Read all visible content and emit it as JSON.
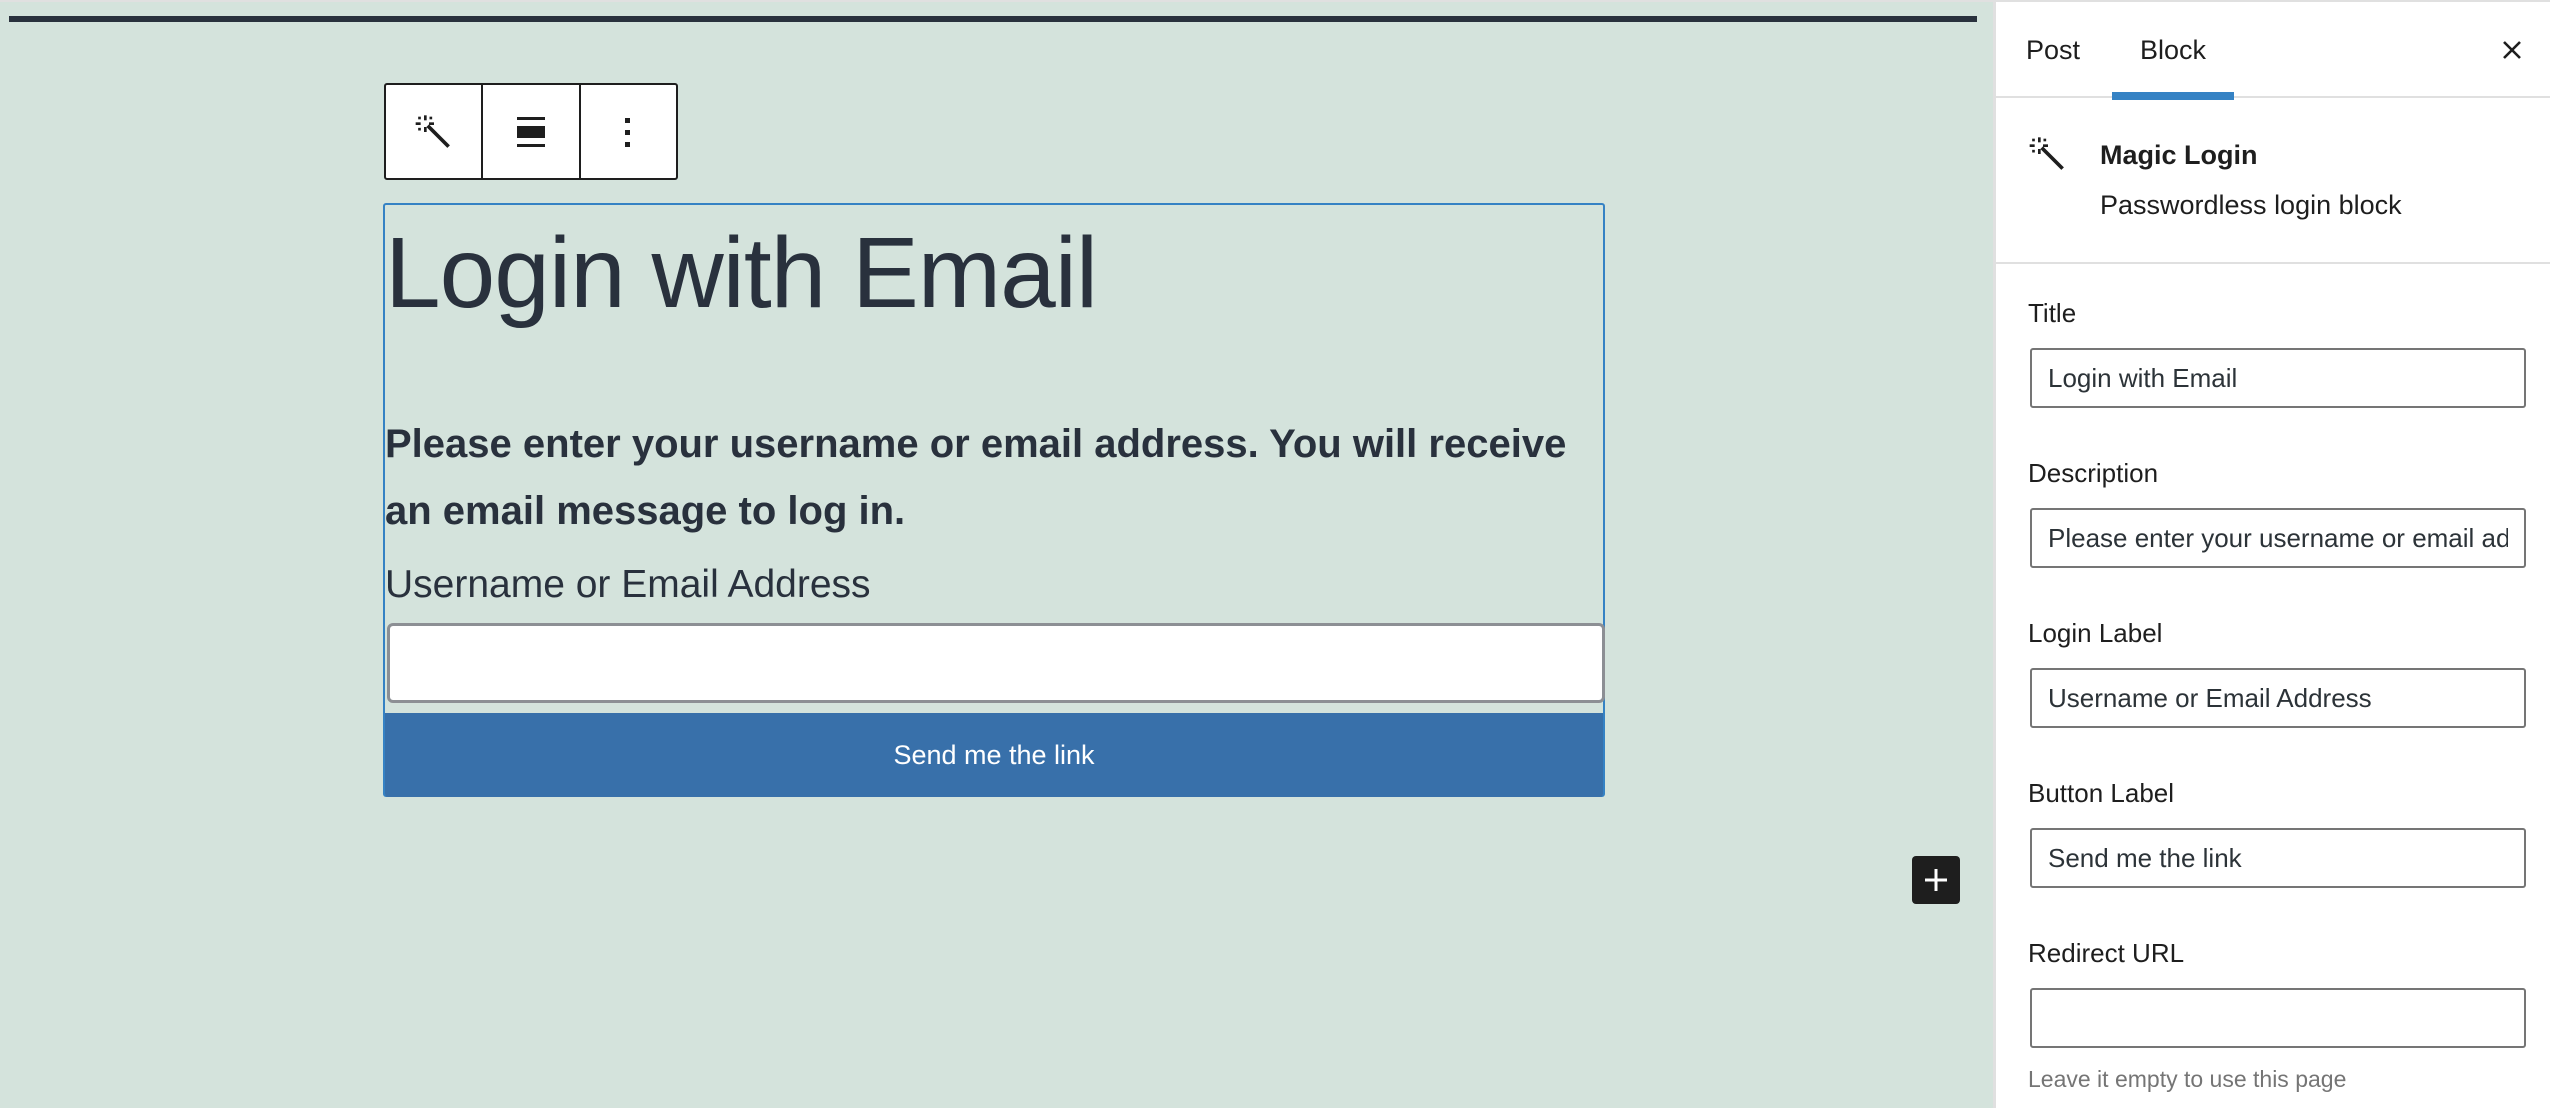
{
  "editor": {
    "toolbar": {
      "buttons": [
        {
          "icon": "magic-wand-icon",
          "label": "Magic Login"
        },
        {
          "icon": "align-icon",
          "label": "Align"
        },
        {
          "icon": "more-options-icon",
          "label": "Options"
        }
      ]
    },
    "block": {
      "title": "Login with Email",
      "description": "Please enter your username or email address. You will receive an email message to log in.",
      "login_label": "Username or Email Address",
      "input_value": "",
      "button_label": "Send me the link"
    },
    "add_block_icon": "plus-icon"
  },
  "colors": {
    "canvas_bg": "#d4e3dc",
    "accent": "#3582c4",
    "button_bg": "#3870aa",
    "text_dark": "#29313d"
  },
  "sidebar": {
    "tabs": [
      {
        "label": "Post",
        "active": false
      },
      {
        "label": "Block",
        "active": true
      }
    ],
    "close_icon": "close-icon",
    "block_card": {
      "icon": "magic-wand-icon",
      "name": "Magic Login",
      "description": "Passwordless login block"
    },
    "fields": [
      {
        "label": "Title",
        "value": "Login with Email"
      },
      {
        "label": "Description",
        "value": "Please enter your username or email address. You will receive an email message to log in."
      },
      {
        "label": "Login Label",
        "value": "Username or Email Address"
      },
      {
        "label": "Button Label",
        "value": "Send me the link"
      },
      {
        "label": "Redirect URL",
        "value": ""
      }
    ],
    "redirect_help": "Leave it empty to use this page"
  }
}
